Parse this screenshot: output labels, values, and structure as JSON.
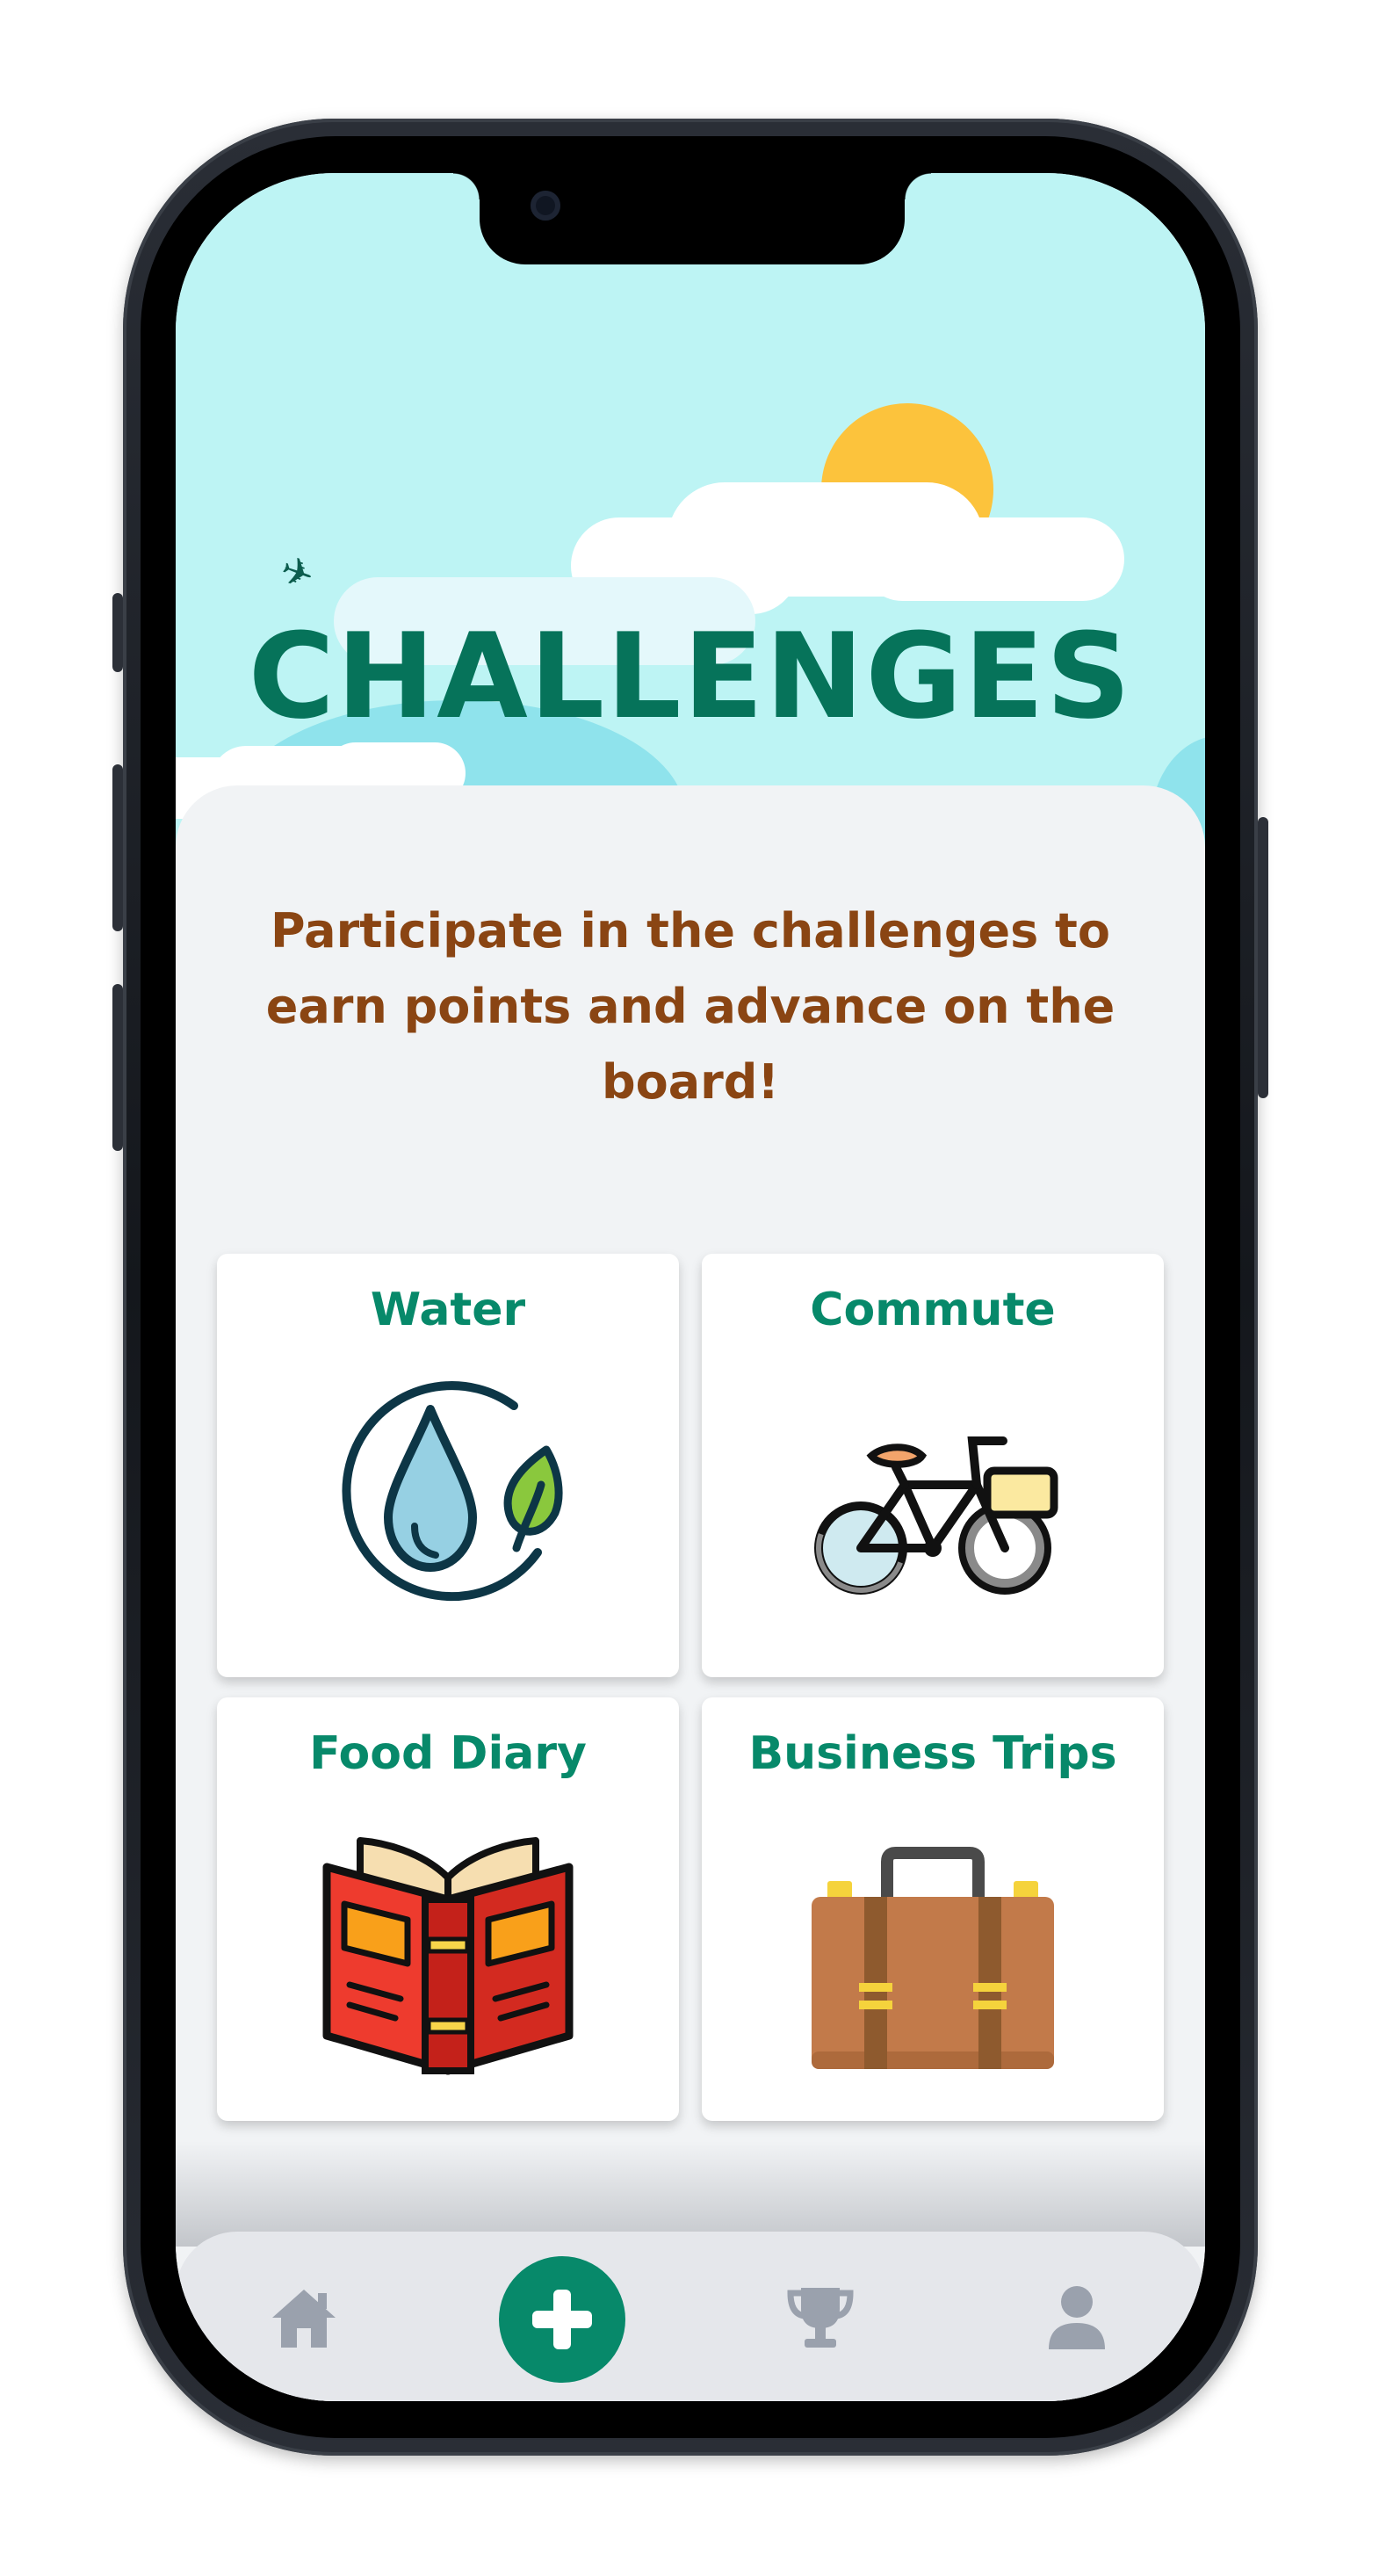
{
  "header": {
    "title": "CHALLENGES"
  },
  "intro": {
    "text": "Participate in the challenges to earn points and advance on the board!"
  },
  "challenges": [
    {
      "label": "Water",
      "icon": "water-drop-leaf-icon"
    },
    {
      "label": "Commute",
      "icon": "bicycle-icon"
    },
    {
      "label": "Food Diary",
      "icon": "book-icon"
    },
    {
      "label": "Business Trips",
      "icon": "briefcase-icon"
    }
  ],
  "tabbar": {
    "items": [
      {
        "icon": "home-icon"
      },
      {
        "icon": "plus-icon"
      },
      {
        "icon": "trophy-icon"
      },
      {
        "icon": "user-icon"
      }
    ]
  },
  "colors": {
    "sky": "#bdf4f4",
    "title": "#06735a",
    "accent": "#07896a",
    "subtitle": "#8a4513",
    "sun": "#fcc33c",
    "tabbar": "#e5e7eb"
  }
}
